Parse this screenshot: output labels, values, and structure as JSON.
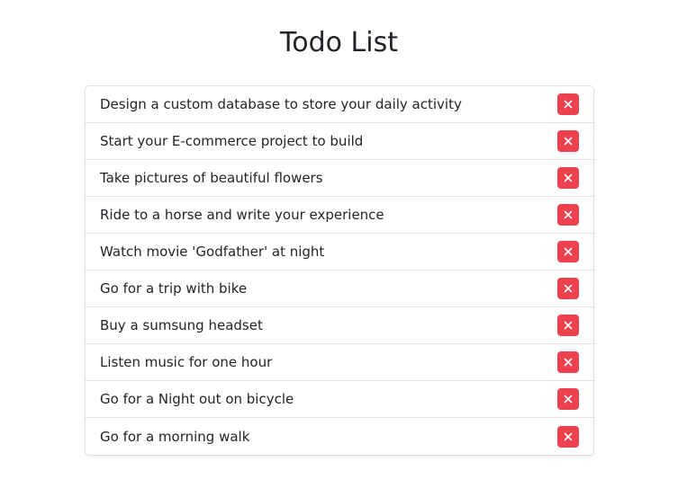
{
  "page": {
    "title": "Todo List"
  },
  "colors": {
    "delete_button": "#ee414f",
    "border": "#dee2e6",
    "text": "#212529"
  },
  "todos": [
    {
      "text": "Design a custom database to store your daily activity",
      "action_icon": "close-icon"
    },
    {
      "text": "Start your E-commerce project to build",
      "action_icon": "close-icon"
    },
    {
      "text": "Take pictures of beautiful flowers",
      "action_icon": "close-icon"
    },
    {
      "text": "Ride to a horse and write your experience",
      "action_icon": "close-icon"
    },
    {
      "text": "Watch movie 'Godfather' at night",
      "action_icon": "close-icon"
    },
    {
      "text": "Go for a trip with bike",
      "action_icon": "close-icon"
    },
    {
      "text": "Buy a sumsung headset",
      "action_icon": "close-icon"
    },
    {
      "text": "Listen music for one hour",
      "action_icon": "close-icon"
    },
    {
      "text": "Go for a Night out on bicycle",
      "action_icon": "close-icon"
    },
    {
      "text": "Go for a morning walk",
      "action_icon": "close-icon"
    }
  ]
}
